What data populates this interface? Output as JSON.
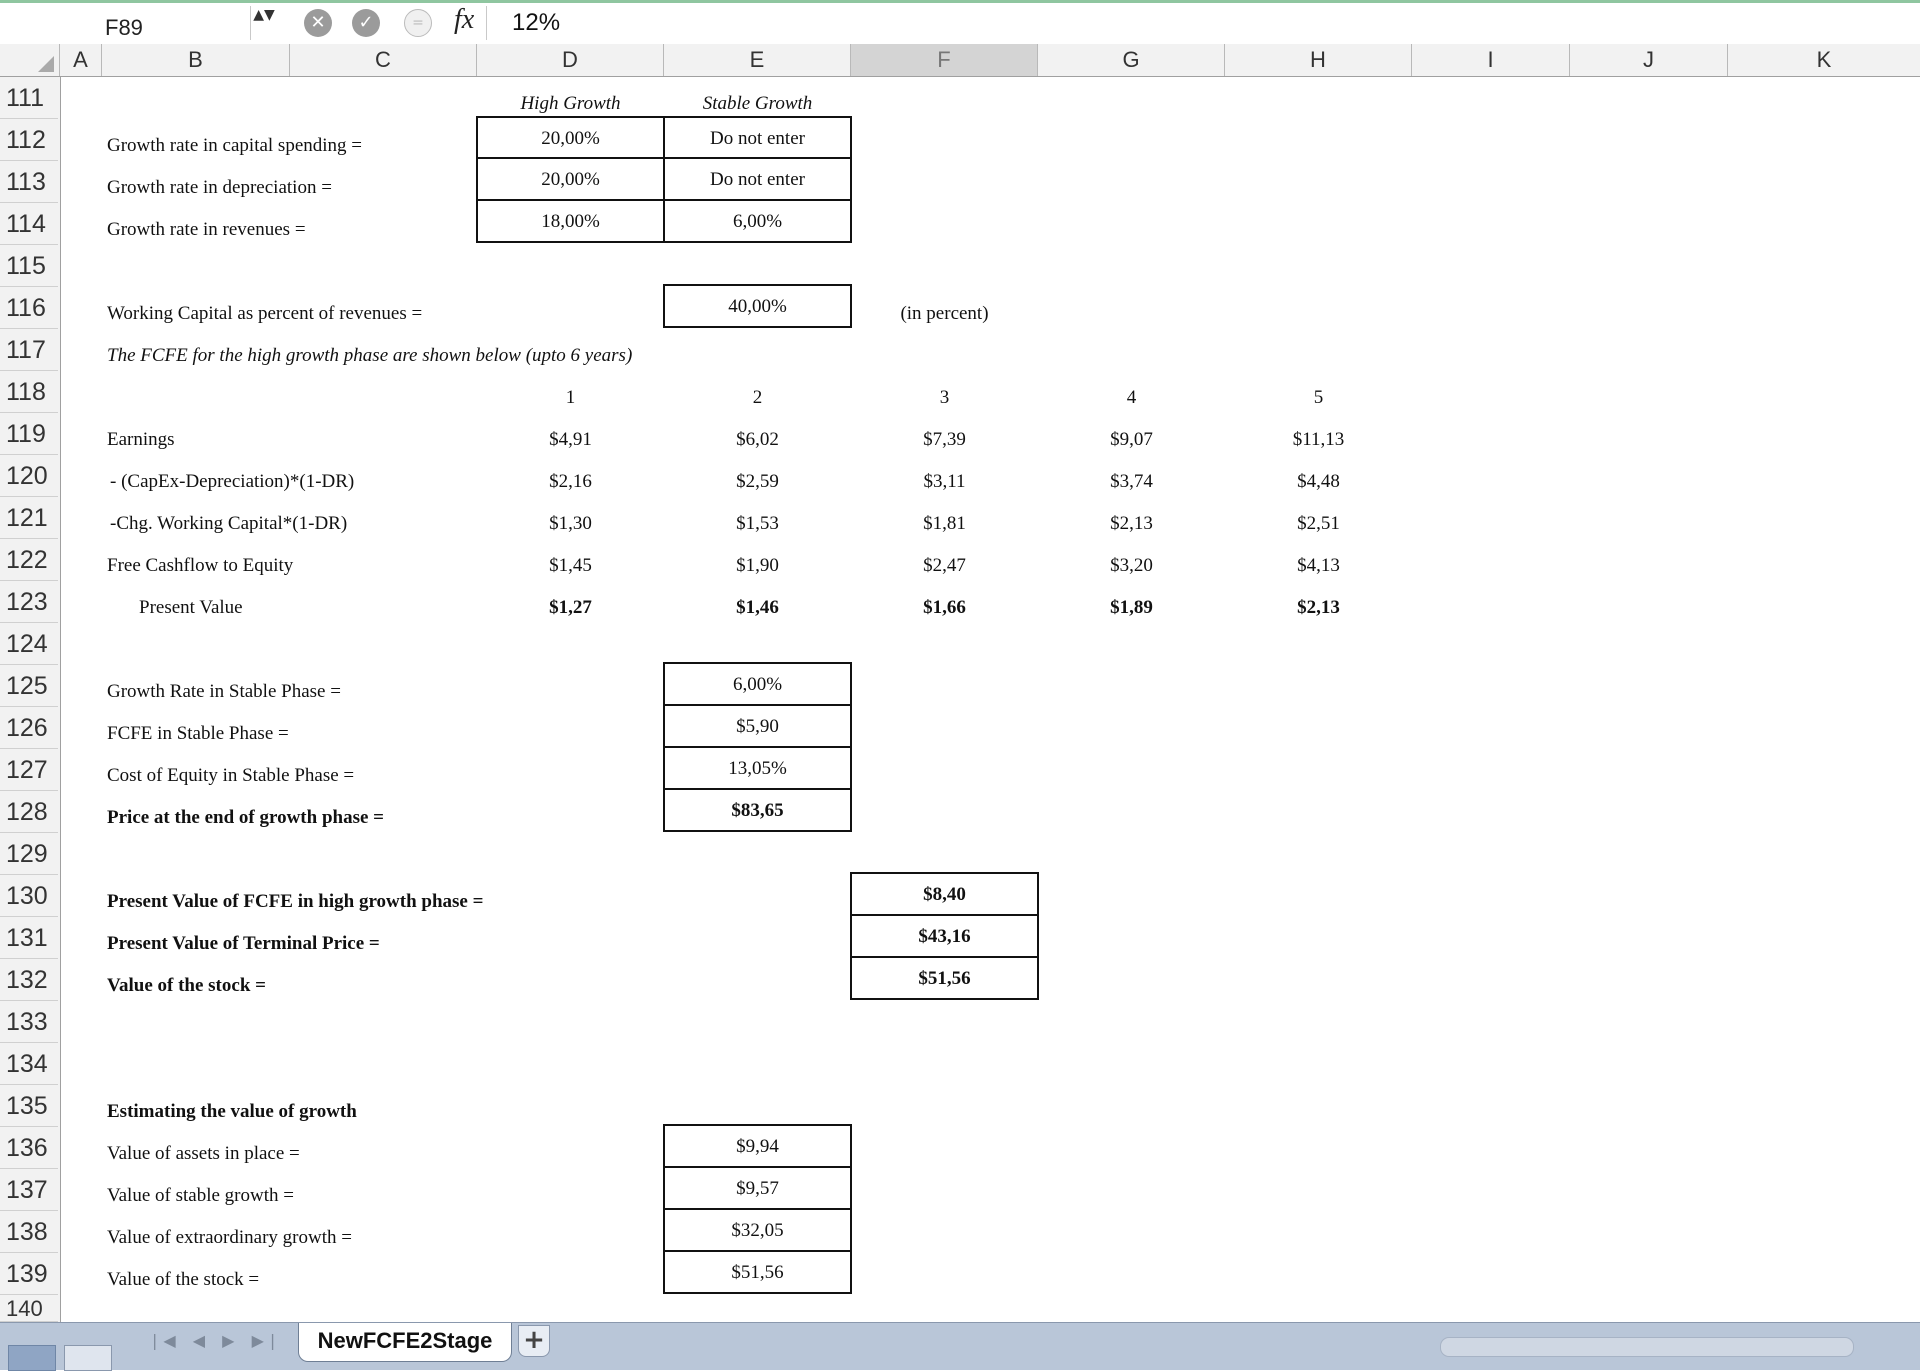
{
  "formula_bar": {
    "name_box": "F89",
    "stepper": "▲▼",
    "cancel_icon": "✕",
    "confirm_icon": "✓",
    "insert_fn_icon": "=",
    "fx": "fx",
    "value": "12%"
  },
  "columns": [
    "A",
    "B",
    "C",
    "D",
    "E",
    "F",
    "G",
    "H",
    "I",
    "J",
    "K"
  ],
  "selected_column": "F",
  "rows": [
    "111",
    "112",
    "113",
    "114",
    "115",
    "116",
    "117",
    "118",
    "119",
    "120",
    "121",
    "122",
    "123",
    "124",
    "125",
    "126",
    "127",
    "128",
    "129",
    "130",
    "131",
    "132",
    "133",
    "134",
    "135",
    "136",
    "137",
    "138",
    "139",
    "140"
  ],
  "sheet": {
    "hdr_high": "High Growth",
    "hdr_stable": "Stable Growth",
    "r112_label": "Growth rate in capital spending =",
    "r112_high": "20,00%",
    "r112_stable": "Do not enter",
    "r113_label": "Growth rate in depreciation =",
    "r113_high": "20,00%",
    "r113_stable": "Do not enter",
    "r114_label": "Growth rate in revenues =",
    "r114_high": "18,00%",
    "r114_stable": "6,00%",
    "r116_label": "Working Capital as percent of revenues =",
    "r116_value": "40,00%",
    "r116_note": "(in percent)",
    "r117_note": "The FCFE for the high growth phase are shown below (upto 6 years)",
    "years": [
      "1",
      "2",
      "3",
      "4",
      "5"
    ],
    "r119_label": "Earnings",
    "r119_values": [
      "$4,91",
      "$6,02",
      "$7,39",
      "$9,07",
      "$11,13"
    ],
    "r120_label": "- (CapEx-Depreciation)*(1-DR)",
    "r120_values": [
      "$2,16",
      "$2,59",
      "$3,11",
      "$3,74",
      "$4,48"
    ],
    "r121_label": "-Chg. Working Capital*(1-DR)",
    "r121_values": [
      "$1,30",
      "$1,53",
      "$1,81",
      "$2,13",
      "$2,51"
    ],
    "r122_label": "Free Cashflow to Equity",
    "r122_values": [
      "$1,45",
      "$1,90",
      "$2,47",
      "$3,20",
      "$4,13"
    ],
    "r123_label": "Present Value",
    "r123_values": [
      "$1,27",
      "$1,46",
      "$1,66",
      "$1,89",
      "$2,13"
    ],
    "r125_label": "Growth Rate in Stable Phase =",
    "r125_value": "6,00%",
    "r126_label": "FCFE in Stable Phase =",
    "r126_value": "$5,90",
    "r127_label": "Cost of Equity in Stable Phase =",
    "r127_value": "13,05%",
    "r128_label": "Price at the end of growth phase =",
    "r128_value": "$83,65",
    "r130_label": "Present Value of FCFE in high growth phase =",
    "r130_value": "$8,40",
    "r131_label": "Present Value of Terminal Price =",
    "r131_value": "$43,16",
    "r132_label": "Value of the stock =",
    "r132_value": "$51,56",
    "r135_label": "Estimating the value of growth",
    "r136_label": "Value of assets in place =",
    "r136_value": "$9,94",
    "r137_label": "Value of stable growth =",
    "r137_value": "$9,57",
    "r138_label": "Value of extraordinary growth =",
    "r138_value": "$32,05",
    "r139_label": "Value of the stock =",
    "r139_value": "$51,56"
  },
  "tabs": {
    "nav": "|◀ ◀ ▶ ▶|",
    "sheet_name": "NewFCFE2Stage",
    "add": "+"
  }
}
